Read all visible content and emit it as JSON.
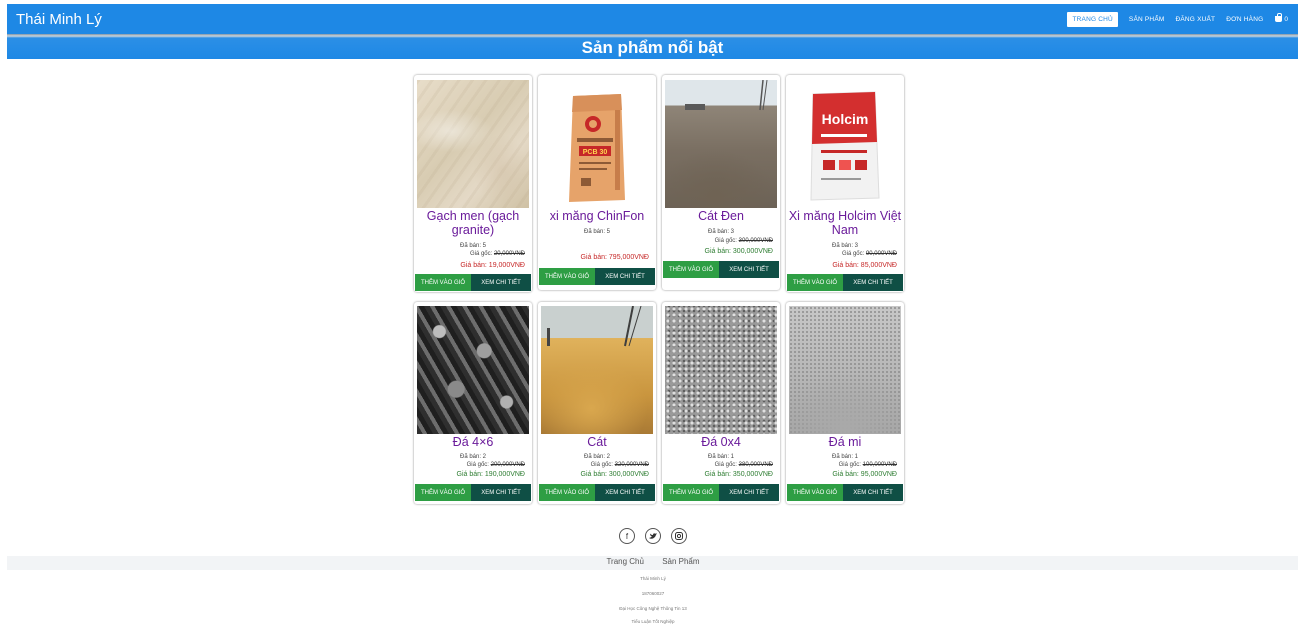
{
  "header": {
    "brand": "Thái Minh Lý",
    "nav": [
      "TRANG CHỦ",
      "SẢN PHẨM",
      "ĐĂNG XUẤT",
      "ĐƠN HÀNG"
    ],
    "cart_count": "0",
    "nav_color": "#1e88e5"
  },
  "banner": {
    "title": "Sản phẩm nổi bật"
  },
  "products": [
    {
      "name_1": "Gạch men (gạch",
      "name_2": "granite)",
      "sold": "Đã bán: 5",
      "orig_label": "Giá gốc:",
      "orig_price": "20,000VNĐ",
      "sale": "Giá bán: 19,000VNĐ",
      "image": "marble-tile"
    },
    {
      "name_1": "xi măng ChinFon",
      "name_2": "",
      "sold": "Đã bán: 5",
      "orig_label": "",
      "orig_price": "",
      "sale": "Giá bán: 795,000VNĐ",
      "image": "cement-bag-pcb30"
    },
    {
      "name_1": "Cát Đen",
      "name_2": "",
      "sold": "Đã bán: 3",
      "orig_label": "Giá gốc:",
      "orig_price": "300,000VNĐ",
      "sale": "Giá bán: 300,000VNĐ",
      "image": "black-sand-pile"
    },
    {
      "name_1": "Xi măng Holcim Việt",
      "name_2": "Nam",
      "sold": "Đã bán: 3",
      "orig_label": "Giá gốc:",
      "orig_price": "90,000VNĐ",
      "sale": "Giá bán: 85,000VNĐ",
      "image": "holcim-cement-bag"
    },
    {
      "name_1": "Đá 4×6",
      "name_2": "",
      "sold": "Đã bán: 2",
      "orig_label": "Giá gốc:",
      "orig_price": "200,000VNĐ",
      "sale": "Giá bán: 190,000VNĐ",
      "image": "stone-4x6"
    },
    {
      "name_1": "Cát",
      "name_2": "",
      "sold": "Đã bán: 2",
      "orig_label": "Giá gốc:",
      "orig_price": "320,000VNĐ",
      "sale": "Giá bán: 300,000VNĐ",
      "image": "yellow-sand-pile"
    },
    {
      "name_1": "Đá 0x4",
      "name_2": "",
      "sold": "Đã bán: 1",
      "orig_label": "Giá gốc:",
      "orig_price": "380,000VNĐ",
      "sale": "Giá bán: 350,000VNĐ",
      "image": "gravel-0x4"
    },
    {
      "name_1": "Đá mi",
      "name_2": "",
      "sold": "Đã bán: 1",
      "orig_label": "Giá gốc:",
      "orig_price": "100,000VNĐ",
      "sale": "Giá bán: 95,000VNĐ",
      "image": "stone-dust"
    }
  ],
  "buttons": {
    "add": "THÊM VÀO GIỎ",
    "view": "XEM CHI TIẾT"
  },
  "footer": {
    "links": [
      "Trang Chủ",
      "Sản Phẩm"
    ],
    "lines": [
      "Thái Minh Lý",
      "187060027",
      "Đại Học Công Nghệ Thông Tin 13",
      "Tiểu Luận Tốt Nghiệp"
    ],
    "social": [
      "facebook-icon",
      "twitter-icon",
      "instagram-icon"
    ]
  }
}
